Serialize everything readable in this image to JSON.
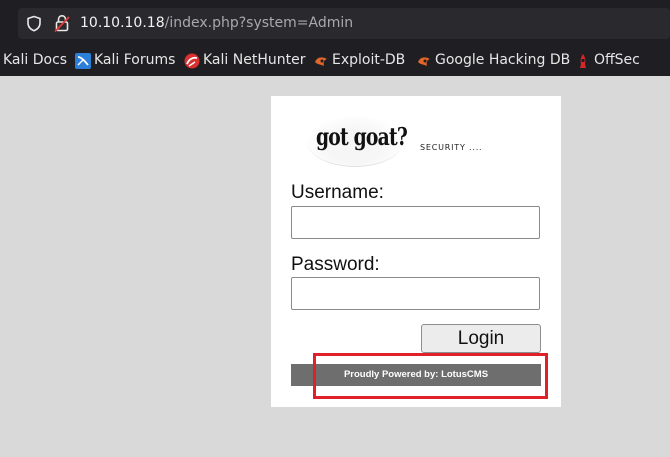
{
  "browser": {
    "url_host": "10.10.10.18",
    "url_path": "/index.php?system=Admin",
    "bookmarks": [
      {
        "label": "Kali Docs",
        "icon": "kali-docs-icon"
      },
      {
        "label": "Kali Forums",
        "icon": "kali-forums-icon"
      },
      {
        "label": "Kali NetHunter",
        "icon": "kali-nethunter-icon"
      },
      {
        "label": "Exploit-DB",
        "icon": "exploit-db-icon"
      },
      {
        "label": "Google Hacking DB",
        "icon": "exploit-db-icon"
      },
      {
        "label": "OffSec",
        "icon": "offsec-icon"
      }
    ]
  },
  "page": {
    "logo_text": "got goat?",
    "tagline": "SECURITY ....",
    "username_label": "Username:",
    "username_value": "",
    "password_label": "Password:",
    "password_value": "",
    "login_button": "Login",
    "footer": "Proudly Powered by: LotusCMS"
  },
  "colors": {
    "background": "#d9d9d9",
    "browser_chrome": "#1f1f23",
    "footer_bar": "#6e6e6e",
    "highlight": "#e0202a"
  }
}
